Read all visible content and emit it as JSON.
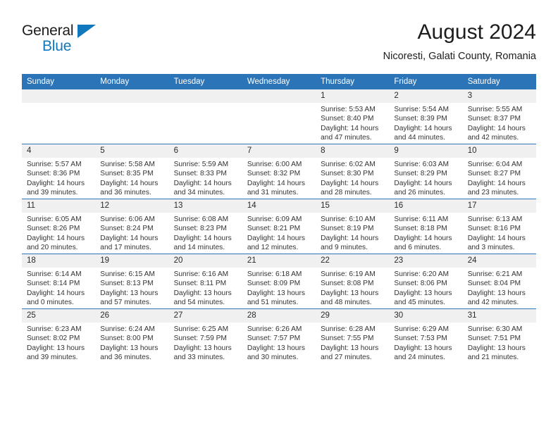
{
  "brand": {
    "name_top": "General",
    "name_bottom": "Blue",
    "accent_color": "#1278be"
  },
  "header": {
    "title": "August 2024",
    "subtitle": "Nicoresti, Galati County, Romania"
  },
  "calendar": {
    "header_color": "#2b74b8",
    "daynum_band_color": "#f0f0f0",
    "weekday_headers": [
      "Sunday",
      "Monday",
      "Tuesday",
      "Wednesday",
      "Thursday",
      "Friday",
      "Saturday"
    ],
    "labels": {
      "sunrise": "Sunrise:",
      "sunset": "Sunset:",
      "daylight": "Daylight:"
    },
    "weeks": [
      [
        {
          "day": "",
          "empty": true,
          "sunrise": "",
          "sunset": "",
          "daylight_1": "",
          "daylight_2": ""
        },
        {
          "day": "",
          "empty": true,
          "sunrise": "",
          "sunset": "",
          "daylight_1": "",
          "daylight_2": ""
        },
        {
          "day": "",
          "empty": true,
          "sunrise": "",
          "sunset": "",
          "daylight_1": "",
          "daylight_2": ""
        },
        {
          "day": "",
          "empty": true,
          "sunrise": "",
          "sunset": "",
          "daylight_1": "",
          "daylight_2": ""
        },
        {
          "day": "1",
          "empty": false,
          "sunrise": "Sunrise: 5:53 AM",
          "sunset": "Sunset: 8:40 PM",
          "daylight_1": "Daylight: 14 hours",
          "daylight_2": "and 47 minutes."
        },
        {
          "day": "2",
          "empty": false,
          "sunrise": "Sunrise: 5:54 AM",
          "sunset": "Sunset: 8:39 PM",
          "daylight_1": "Daylight: 14 hours",
          "daylight_2": "and 44 minutes."
        },
        {
          "day": "3",
          "empty": false,
          "sunrise": "Sunrise: 5:55 AM",
          "sunset": "Sunset: 8:37 PM",
          "daylight_1": "Daylight: 14 hours",
          "daylight_2": "and 42 minutes."
        }
      ],
      [
        {
          "day": "4",
          "empty": false,
          "sunrise": "Sunrise: 5:57 AM",
          "sunset": "Sunset: 8:36 PM",
          "daylight_1": "Daylight: 14 hours",
          "daylight_2": "and 39 minutes."
        },
        {
          "day": "5",
          "empty": false,
          "sunrise": "Sunrise: 5:58 AM",
          "sunset": "Sunset: 8:35 PM",
          "daylight_1": "Daylight: 14 hours",
          "daylight_2": "and 36 minutes."
        },
        {
          "day": "6",
          "empty": false,
          "sunrise": "Sunrise: 5:59 AM",
          "sunset": "Sunset: 8:33 PM",
          "daylight_1": "Daylight: 14 hours",
          "daylight_2": "and 34 minutes."
        },
        {
          "day": "7",
          "empty": false,
          "sunrise": "Sunrise: 6:00 AM",
          "sunset": "Sunset: 8:32 PM",
          "daylight_1": "Daylight: 14 hours",
          "daylight_2": "and 31 minutes."
        },
        {
          "day": "8",
          "empty": false,
          "sunrise": "Sunrise: 6:02 AM",
          "sunset": "Sunset: 8:30 PM",
          "daylight_1": "Daylight: 14 hours",
          "daylight_2": "and 28 minutes."
        },
        {
          "day": "9",
          "empty": false,
          "sunrise": "Sunrise: 6:03 AM",
          "sunset": "Sunset: 8:29 PM",
          "daylight_1": "Daylight: 14 hours",
          "daylight_2": "and 26 minutes."
        },
        {
          "day": "10",
          "empty": false,
          "sunrise": "Sunrise: 6:04 AM",
          "sunset": "Sunset: 8:27 PM",
          "daylight_1": "Daylight: 14 hours",
          "daylight_2": "and 23 minutes."
        }
      ],
      [
        {
          "day": "11",
          "empty": false,
          "sunrise": "Sunrise: 6:05 AM",
          "sunset": "Sunset: 8:26 PM",
          "daylight_1": "Daylight: 14 hours",
          "daylight_2": "and 20 minutes."
        },
        {
          "day": "12",
          "empty": false,
          "sunrise": "Sunrise: 6:06 AM",
          "sunset": "Sunset: 8:24 PM",
          "daylight_1": "Daylight: 14 hours",
          "daylight_2": "and 17 minutes."
        },
        {
          "day": "13",
          "empty": false,
          "sunrise": "Sunrise: 6:08 AM",
          "sunset": "Sunset: 8:23 PM",
          "daylight_1": "Daylight: 14 hours",
          "daylight_2": "and 14 minutes."
        },
        {
          "day": "14",
          "empty": false,
          "sunrise": "Sunrise: 6:09 AM",
          "sunset": "Sunset: 8:21 PM",
          "daylight_1": "Daylight: 14 hours",
          "daylight_2": "and 12 minutes."
        },
        {
          "day": "15",
          "empty": false,
          "sunrise": "Sunrise: 6:10 AM",
          "sunset": "Sunset: 8:19 PM",
          "daylight_1": "Daylight: 14 hours",
          "daylight_2": "and 9 minutes."
        },
        {
          "day": "16",
          "empty": false,
          "sunrise": "Sunrise: 6:11 AM",
          "sunset": "Sunset: 8:18 PM",
          "daylight_1": "Daylight: 14 hours",
          "daylight_2": "and 6 minutes."
        },
        {
          "day": "17",
          "empty": false,
          "sunrise": "Sunrise: 6:13 AM",
          "sunset": "Sunset: 8:16 PM",
          "daylight_1": "Daylight: 14 hours",
          "daylight_2": "and 3 minutes."
        }
      ],
      [
        {
          "day": "18",
          "empty": false,
          "sunrise": "Sunrise: 6:14 AM",
          "sunset": "Sunset: 8:14 PM",
          "daylight_1": "Daylight: 14 hours",
          "daylight_2": "and 0 minutes."
        },
        {
          "day": "19",
          "empty": false,
          "sunrise": "Sunrise: 6:15 AM",
          "sunset": "Sunset: 8:13 PM",
          "daylight_1": "Daylight: 13 hours",
          "daylight_2": "and 57 minutes."
        },
        {
          "day": "20",
          "empty": false,
          "sunrise": "Sunrise: 6:16 AM",
          "sunset": "Sunset: 8:11 PM",
          "daylight_1": "Daylight: 13 hours",
          "daylight_2": "and 54 minutes."
        },
        {
          "day": "21",
          "empty": false,
          "sunrise": "Sunrise: 6:18 AM",
          "sunset": "Sunset: 8:09 PM",
          "daylight_1": "Daylight: 13 hours",
          "daylight_2": "and 51 minutes."
        },
        {
          "day": "22",
          "empty": false,
          "sunrise": "Sunrise: 6:19 AM",
          "sunset": "Sunset: 8:08 PM",
          "daylight_1": "Daylight: 13 hours",
          "daylight_2": "and 48 minutes."
        },
        {
          "day": "23",
          "empty": false,
          "sunrise": "Sunrise: 6:20 AM",
          "sunset": "Sunset: 8:06 PM",
          "daylight_1": "Daylight: 13 hours",
          "daylight_2": "and 45 minutes."
        },
        {
          "day": "24",
          "empty": false,
          "sunrise": "Sunrise: 6:21 AM",
          "sunset": "Sunset: 8:04 PM",
          "daylight_1": "Daylight: 13 hours",
          "daylight_2": "and 42 minutes."
        }
      ],
      [
        {
          "day": "25",
          "empty": false,
          "sunrise": "Sunrise: 6:23 AM",
          "sunset": "Sunset: 8:02 PM",
          "daylight_1": "Daylight: 13 hours",
          "daylight_2": "and 39 minutes."
        },
        {
          "day": "26",
          "empty": false,
          "sunrise": "Sunrise: 6:24 AM",
          "sunset": "Sunset: 8:00 PM",
          "daylight_1": "Daylight: 13 hours",
          "daylight_2": "and 36 minutes."
        },
        {
          "day": "27",
          "empty": false,
          "sunrise": "Sunrise: 6:25 AM",
          "sunset": "Sunset: 7:59 PM",
          "daylight_1": "Daylight: 13 hours",
          "daylight_2": "and 33 minutes."
        },
        {
          "day": "28",
          "empty": false,
          "sunrise": "Sunrise: 6:26 AM",
          "sunset": "Sunset: 7:57 PM",
          "daylight_1": "Daylight: 13 hours",
          "daylight_2": "and 30 minutes."
        },
        {
          "day": "29",
          "empty": false,
          "sunrise": "Sunrise: 6:28 AM",
          "sunset": "Sunset: 7:55 PM",
          "daylight_1": "Daylight: 13 hours",
          "daylight_2": "and 27 minutes."
        },
        {
          "day": "30",
          "empty": false,
          "sunrise": "Sunrise: 6:29 AM",
          "sunset": "Sunset: 7:53 PM",
          "daylight_1": "Daylight: 13 hours",
          "daylight_2": "and 24 minutes."
        },
        {
          "day": "31",
          "empty": false,
          "sunrise": "Sunrise: 6:30 AM",
          "sunset": "Sunset: 7:51 PM",
          "daylight_1": "Daylight: 13 hours",
          "daylight_2": "and 21 minutes."
        }
      ]
    ]
  }
}
